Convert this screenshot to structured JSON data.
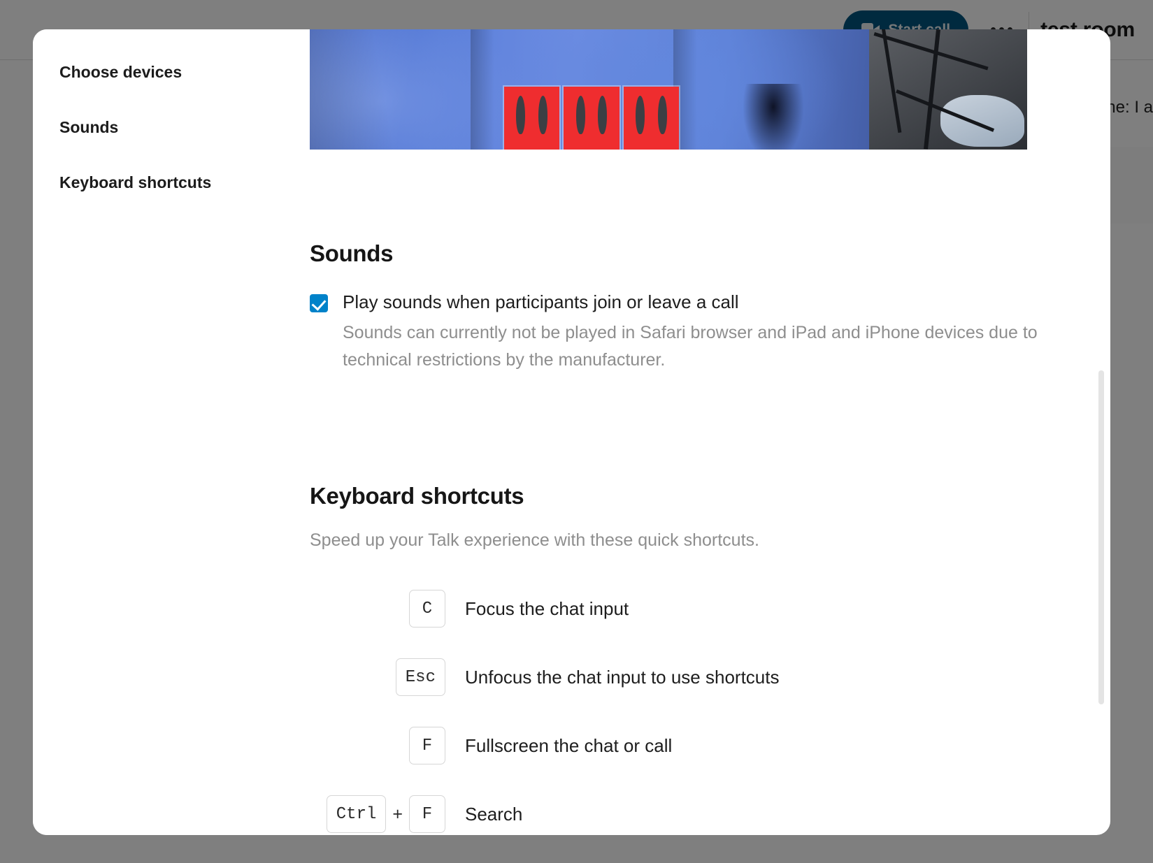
{
  "background": {
    "start_call_label": "Start call",
    "camera_icon": "video-camera-icon",
    "more_actions_icon": "three-dots-icon",
    "room_title": "test room",
    "message_fragment": "ne: I a"
  },
  "modal": {
    "nav": {
      "items": [
        {
          "label": "Choose devices",
          "name": "choose-devices"
        },
        {
          "label": "Sounds",
          "name": "sounds"
        },
        {
          "label": "Keyboard shortcuts",
          "name": "keyboard-shortcuts"
        }
      ]
    },
    "device_preview": {
      "alt": "camera-preview"
    },
    "sounds": {
      "heading": "Sounds",
      "checkbox": {
        "checked": true,
        "label": "Play sounds when participants join or leave a call",
        "hint": "Sounds can currently not be played in Safari browser and iPad and iPhone devices due to technical restrictions by the manufacturer."
      }
    },
    "keyboard_shortcuts": {
      "heading": "Keyboard shortcuts",
      "subtitle": "Speed up your Talk experience with these quick shortcuts.",
      "rows": [
        {
          "keys": [
            "C"
          ],
          "description": "Focus the chat input"
        },
        {
          "keys": [
            "Esc"
          ],
          "description": "Unfocus the chat input to use shortcuts"
        },
        {
          "keys": [
            "F"
          ],
          "description": "Fullscreen the chat or call"
        },
        {
          "keys": [
            "Ctrl",
            "F"
          ],
          "description": "Search"
        }
      ],
      "separator": "+"
    }
  },
  "colors": {
    "accent_checkbox": "#0082c9",
    "start_call_button": "#00557e",
    "overlay": "rgba(0,0,0,0.50)",
    "muted_text": "#8e8e8e"
  }
}
